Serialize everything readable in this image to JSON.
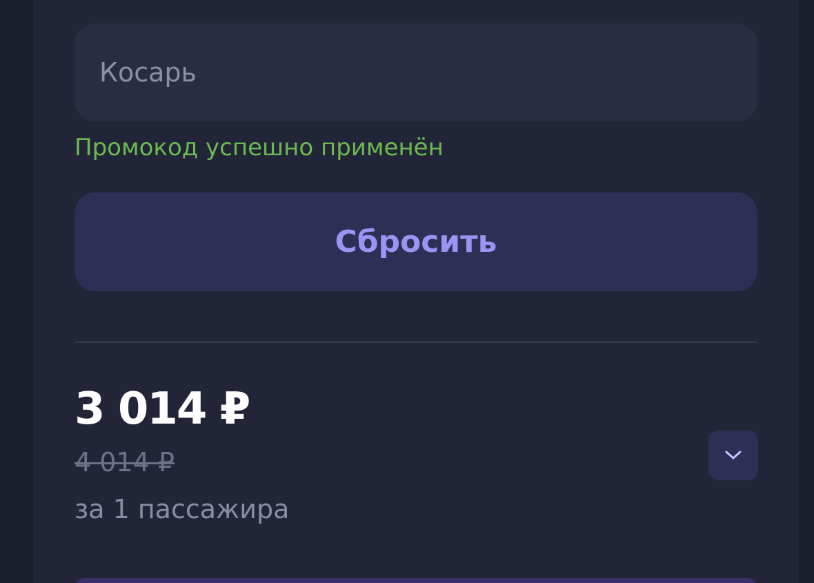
{
  "promo": {
    "input_value": "Косарь",
    "status_text": "Промокод успешно применён",
    "reset_label": "Сбросить"
  },
  "price": {
    "current": "3 014 ₽",
    "original": "4 014 ₽",
    "per_passenger": "за 1 пассажира"
  },
  "icons": {
    "expand": "chevron-down-icon"
  },
  "colors": {
    "success": "#6cb94f",
    "accent": "#9d93f2",
    "button_bg": "#2d2f55"
  }
}
